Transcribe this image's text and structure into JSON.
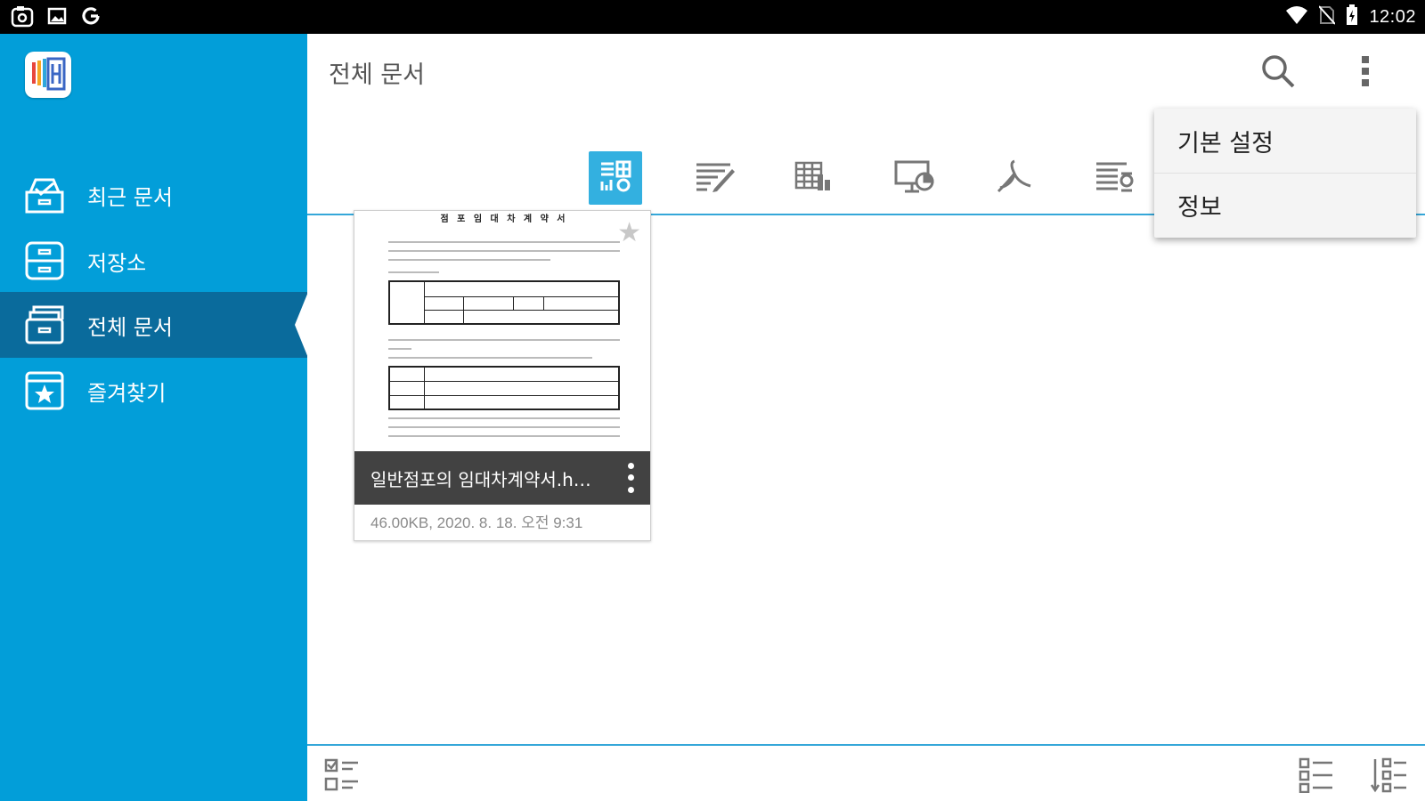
{
  "status_bar": {
    "left_icons": [
      "camera-icon",
      "gallery-icon",
      "google-icon"
    ],
    "right_icons": [
      "wifi-icon",
      "no-sim-icon",
      "battery-charging-icon"
    ],
    "time": "12:02"
  },
  "sidebar": {
    "logo_icon": "hancom-viewer-logo-icon",
    "items": [
      {
        "label": "최근 문서",
        "icon": "recent-inbox-icon",
        "active": false
      },
      {
        "label": "저장소",
        "icon": "storage-drawer-icon",
        "active": false
      },
      {
        "label": "전체 문서",
        "icon": "all-documents-icon",
        "active": true
      },
      {
        "label": "즐겨찾기",
        "icon": "favorite-star-icon",
        "active": false
      }
    ]
  },
  "header": {
    "title": "전체 문서",
    "search_icon": "search-icon",
    "more_icon": "more-vert-icon"
  },
  "filters": [
    {
      "name": "all-types",
      "icon": "all-types-icon",
      "active": true
    },
    {
      "name": "word",
      "icon": "word-doc-icon",
      "active": false
    },
    {
      "name": "sheet",
      "icon": "spreadsheet-icon",
      "active": false
    },
    {
      "name": "slide",
      "icon": "presentation-icon",
      "active": false
    },
    {
      "name": "pdf",
      "icon": "pdf-icon",
      "active": false
    },
    {
      "name": "hwp",
      "icon": "hwp-doc-icon",
      "active": false
    }
  ],
  "document": {
    "name": "일반점포의 임대차계약서.h…",
    "meta": "46.00KB, 2020. 8. 18. 오전 9:31",
    "preview_title": "점 포 임 대 차 계 약 서",
    "starred": false
  },
  "popup_menu": {
    "items": [
      "기본 설정",
      "정보"
    ]
  },
  "bottom_bar": {
    "select_icon": "multi-select-icon",
    "view_icon": "list-view-icon",
    "sort_icon": "sort-icon"
  },
  "colors": {
    "sidebar": "#029ed9",
    "sidebar_active": "#0a6b9c",
    "accent": "#33b0e0"
  }
}
